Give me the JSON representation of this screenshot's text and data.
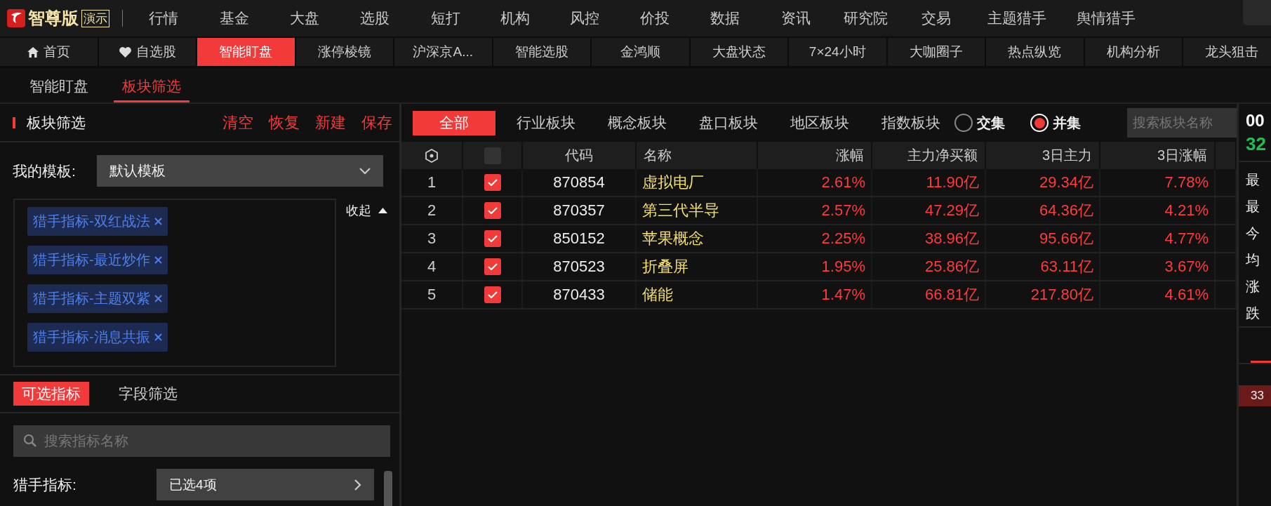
{
  "app_bar": {
    "brand": "智尊版",
    "badge": "演示",
    "menu": [
      "行情",
      "基金",
      "大盘",
      "选股",
      "短打",
      "机构",
      "风控",
      "价投",
      "数据",
      "资讯",
      "研究院",
      "交易",
      "主题猎手",
      "舆情猎手"
    ]
  },
  "tabs": [
    {
      "label": "首页",
      "selected": false
    },
    {
      "label": "自选股",
      "selected": false
    },
    {
      "label": "智能盯盘",
      "selected": true
    },
    {
      "label": "涨停棱镜",
      "selected": false
    },
    {
      "label": "沪深京A...",
      "selected": false
    },
    {
      "label": "智能选股",
      "selected": false
    },
    {
      "label": "金鸿顺",
      "selected": false
    },
    {
      "label": "大盘状态",
      "selected": false
    },
    {
      "label": "7×24小时",
      "selected": false
    },
    {
      "label": "大咖圈子",
      "selected": false
    },
    {
      "label": "热点纵览",
      "selected": false
    },
    {
      "label": "机构分析",
      "selected": false
    },
    {
      "label": "龙头狙击",
      "selected": false
    }
  ],
  "sub_tabs": [
    {
      "label": "智能盯盘",
      "selected": false
    },
    {
      "label": "板块筛选",
      "selected": true
    }
  ],
  "filter_panel": {
    "title": "板块筛选",
    "actions": [
      "清空",
      "恢复",
      "新建",
      "保存"
    ],
    "template_label": "我的模板:",
    "template_value": "默认模板",
    "collapse_label": "收起",
    "tags": [
      "猎手指标-双红战法",
      "猎手指标-最近炒作",
      "猎手指标-主题双紫",
      "猎手指标-消息共振"
    ],
    "tabs": [
      {
        "label": "可选指标",
        "selected": true
      },
      {
        "label": "字段筛选",
        "selected": false
      }
    ],
    "search": {
      "placeholder": "搜索指标名称"
    },
    "field_label": "猎手指标:",
    "field_value": "已选4项"
  },
  "main": {
    "categories": [
      {
        "label": "全部",
        "selected": true
      },
      {
        "label": "行业板块",
        "selected": false
      },
      {
        "label": "概念板块",
        "selected": false
      },
      {
        "label": "盘口板块",
        "selected": false
      },
      {
        "label": "地区板块",
        "selected": false
      },
      {
        "label": "指数板块",
        "selected": false
      }
    ],
    "set_options": [
      {
        "label": "交集",
        "selected": false
      },
      {
        "label": "并集",
        "selected": true
      }
    ],
    "search": {
      "placeholder": "搜索板块名称"
    },
    "table": {
      "header_checked": false,
      "columns": [
        "代码",
        "名称",
        "涨幅",
        "主力净买额",
        "3日主力",
        "3日涨幅"
      ],
      "rows": [
        {
          "index": "1",
          "checked": true,
          "code": "870854",
          "name": "虚拟电厂",
          "change": "2.61%",
          "net_buy": "11.90亿",
          "main_3d": "29.34亿",
          "change_3d": "7.78%"
        },
        {
          "index": "2",
          "checked": true,
          "code": "870357",
          "name": "第三代半导",
          "change": "2.57%",
          "net_buy": "47.29亿",
          "main_3d": "64.36亿",
          "change_3d": "4.21%"
        },
        {
          "index": "3",
          "checked": true,
          "code": "850152",
          "name": "苹果概念",
          "change": "2.25%",
          "net_buy": "38.96亿",
          "main_3d": "95.66亿",
          "change_3d": "4.77%"
        },
        {
          "index": "4",
          "checked": true,
          "code": "870523",
          "name": "折叠屏",
          "change": "1.95%",
          "net_buy": "25.86亿",
          "main_3d": "63.11亿",
          "change_3d": "3.67%"
        },
        {
          "index": "5",
          "checked": true,
          "code": "870433",
          "name": "储能",
          "change": "1.47%",
          "net_buy": "66.81亿",
          "main_3d": "217.80亿",
          "change_3d": "4.61%"
        }
      ]
    }
  },
  "quote_panel": {
    "code": "00",
    "price": "32",
    "stats": [
      "最",
      "最",
      "今",
      "均",
      "涨",
      "跌"
    ],
    "price_tag": "33"
  }
}
